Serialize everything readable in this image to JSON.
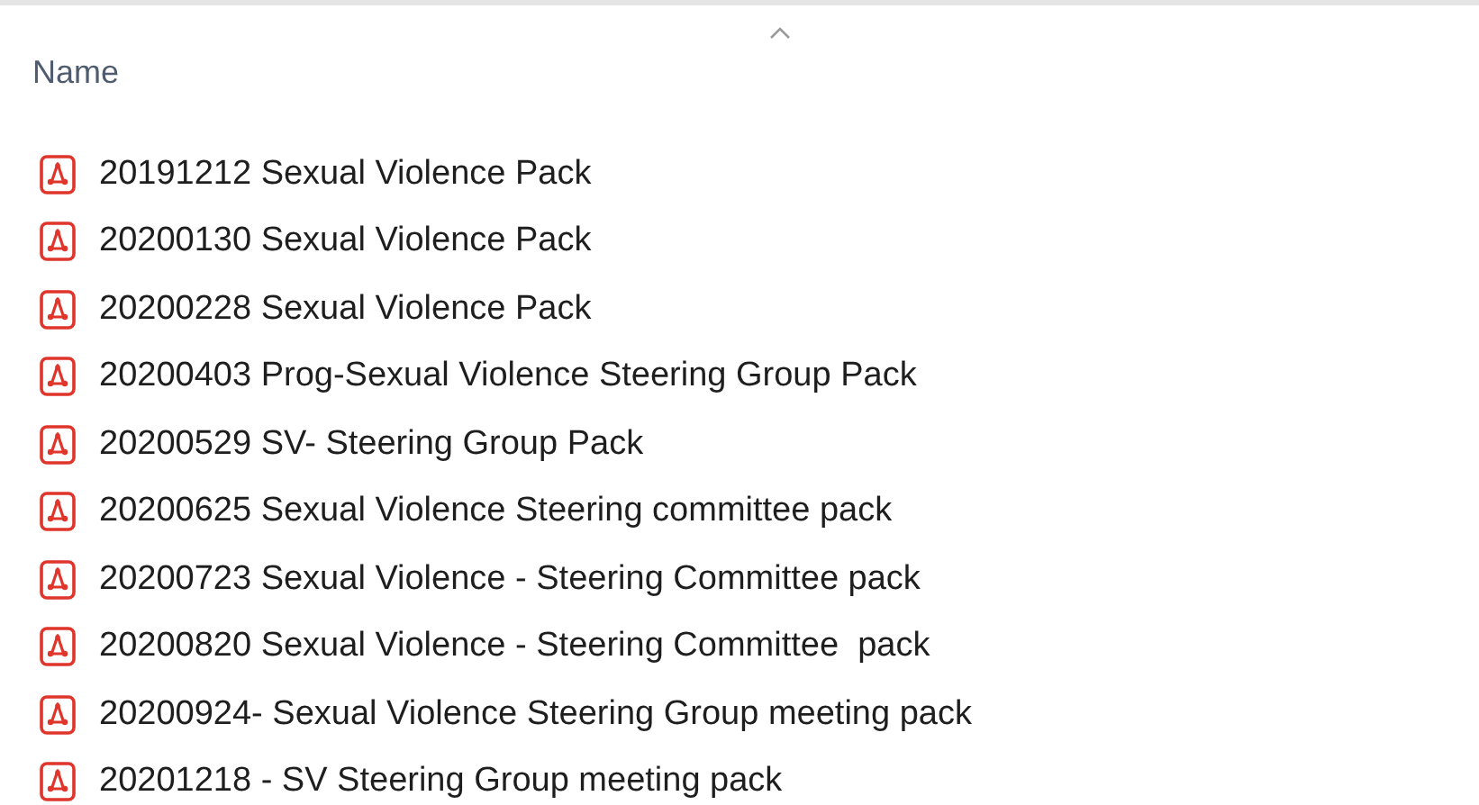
{
  "column_header": {
    "label": "Name"
  },
  "files": [
    {
      "name": "20191212 Sexual Violence Pack"
    },
    {
      "name": "20200130 Sexual Violence Pack"
    },
    {
      "name": "20200228 Sexual Violence Pack"
    },
    {
      "name": "20200403 Prog-Sexual Violence Steering Group Pack"
    },
    {
      "name": "20200529 SV- Steering Group Pack"
    },
    {
      "name": "20200625 Sexual Violence Steering committee pack"
    },
    {
      "name": "20200723 Sexual Violence - Steering Committee pack"
    },
    {
      "name": "20200820 Sexual Violence - Steering Committee  pack"
    },
    {
      "name": "20200924- Sexual Violence Steering Group meeting pack"
    },
    {
      "name": "20201218 - SV Steering Group meeting pack"
    }
  ]
}
